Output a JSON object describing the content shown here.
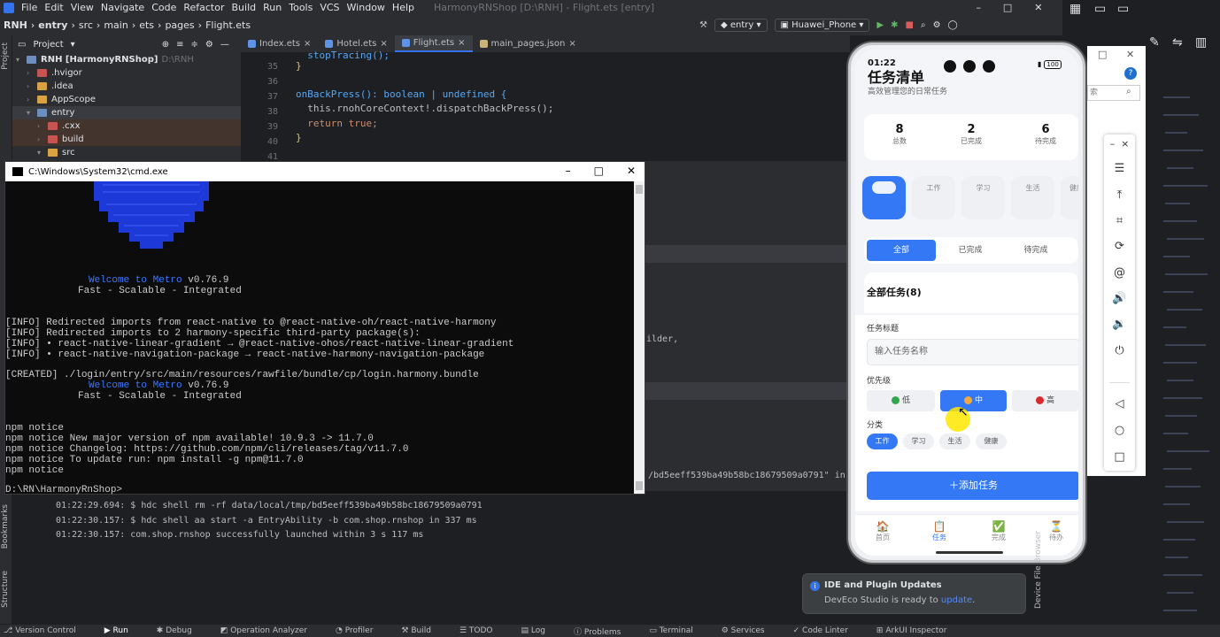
{
  "menu": [
    "File",
    "Edit",
    "View",
    "Navigate",
    "Code",
    "Refactor",
    "Build",
    "Run",
    "Tools",
    "VCS",
    "Window",
    "Help"
  ],
  "window_title": "HarmonyRNShop [D:\\RNH] - Flight.ets [entry]",
  "breadcrumb": [
    "RNH",
    "entry",
    "src",
    "main",
    "ets",
    "pages",
    "Flight.ets"
  ],
  "run_config": "entry",
  "device": "Huawei_Phone",
  "project_header": "Project",
  "tabs": [
    "Index.ets",
    "Hotel.ets",
    "Flight.ets",
    "main_pages.json"
  ],
  "tree": [
    {
      "label": "RNH [HarmonyRNShop]",
      "hint": "D:\\RNH",
      "icon": "module"
    },
    {
      "label": ".hvigor",
      "icon": "folder-red"
    },
    {
      "label": ".idea",
      "icon": "folder"
    },
    {
      "label": "AppScope",
      "icon": "folder"
    },
    {
      "label": "entry",
      "icon": "folder-blue"
    },
    {
      "label": ".cxx",
      "icon": "folder-red"
    },
    {
      "label": "build",
      "icon": "folder-red"
    },
    {
      "label": "src",
      "icon": "folder"
    }
  ],
  "code": {
    "line_numbers": [
      "35",
      "36",
      "37",
      "38",
      "39",
      "40",
      "41"
    ],
    "lines": [
      "  stopTracing();",
      "}",
      "",
      "onBackPress(): boolean | undefined {",
      "  this.rnohCoreContext!.dispatchBackPress();",
      "  return true;",
      "}"
    ]
  },
  "cmd": {
    "title": "C:\\Windows\\System32\\cmd.exe",
    "welcome1": "Welcome to Metro v0.76.9",
    "tagline1": "Fast - Scalable - Integrated",
    "info1": "[INFO] Redirected imports from react-native to @react-native-oh/react-native-harmony",
    "info2": "[INFO] Redirected imports to 2 harmony-specific third-party package(s):",
    "info3": "[INFO] • react-native-linear-gradient → @react-native-ohos/react-native-linear-gradient",
    "info4": "[INFO] • react-native-navigation-package → react-native-harmony-navigation-package",
    "created": "[CREATED] ./login/entry/src/main/resources/rawfile/bundle/cp/login.harmony.bundle",
    "welcome2": "Welcome to Metro v0.76.9",
    "tagline2": "Fast - Scalable - Integrated",
    "npm1": "npm notice",
    "npm2": "npm notice New major version of npm available! 10.9.3 -> 11.7.0",
    "npm3": "npm notice Changelog: https://github.com/npm/cli/releases/tag/v11.7.0",
    "npm4": "npm notice To update run: npm install -g npm@11.7.0",
    "npm5": "npm notice",
    "prompt": "D:\\RN\\HarmonyRnShop>"
  },
  "log": {
    "l1": "01:22:29.694: $ hdc shell rm -rf data/local/tmp/bd5eeff539ba49b58bc18679509a0791",
    "l2": "01:22:30.157: $ hdc shell aa start -a EntryAbility -b com.shop.rnshop in 337 ms",
    "l3": "01:22:30.157: com.shop.rnshop successfully launched within 3 s 117 ms",
    "partial1": "ilder,",
    "partial2": "/bd5eeff539ba49b58bc18679509a0791\" in"
  },
  "app": {
    "time": "01:22",
    "battery": "100",
    "title": "任务清单",
    "subtitle": "高效管理您的日常任务",
    "stats": [
      {
        "value": "8",
        "label": "总数"
      },
      {
        "value": "2",
        "label": "已完成"
      },
      {
        "value": "6",
        "label": "待完成"
      }
    ],
    "categories_chips": [
      "工作",
      "学习",
      "生活",
      "健康"
    ],
    "filters": [
      "全部",
      "已完成",
      "待完成"
    ],
    "list_title": "全部任务(8)",
    "form_title_label": "任务标题",
    "input_placeholder": "输入任务名称",
    "priority_label": "优先级",
    "priorities": [
      "低",
      "中",
      "高"
    ],
    "category_label": "分类",
    "category_options": [
      "工作",
      "学习",
      "生活",
      "健康"
    ],
    "add_button": "添加任务",
    "nav": [
      "首页",
      "任务",
      "完成",
      "待办"
    ],
    "accent": "#3478f6"
  },
  "notification": {
    "title": "IDE and Plugin Updates",
    "body": "DevEco Studio is ready to ",
    "link": "update"
  },
  "status_tools": [
    "Version Control",
    "Run",
    "Debug",
    "Operation Analyzer",
    "Profiler",
    "Build",
    "TODO",
    "Log",
    "Problems",
    "Terminal",
    "Services",
    "Code Linter",
    "ArkUI Inspector"
  ],
  "side_labels": {
    "project": "Project",
    "bookmarks": "Bookmarks",
    "structure": "Structure",
    "device_browser": "Device File Browser"
  }
}
